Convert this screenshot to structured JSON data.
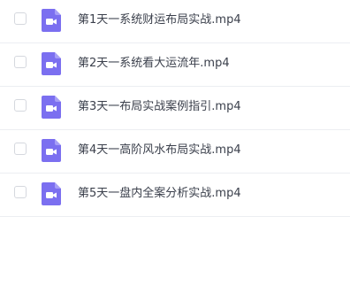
{
  "files": [
    {
      "name": "第1天一系统财运布局实战.mp4",
      "icon": "video-file-icon"
    },
    {
      "name": "第2天一系统看大运流年.mp4",
      "icon": "video-file-icon"
    },
    {
      "name": "第3天一布局实战案例指引.mp4",
      "icon": "video-file-icon"
    },
    {
      "name": "第4天一高阶风水布局实战.mp4",
      "icon": "video-file-icon"
    },
    {
      "name": "第5天一盘内全案分析实战.mp4",
      "icon": "video-file-icon"
    }
  ],
  "colors": {
    "icon_purple": "#7b6ff0",
    "row_divider": "#eceef2",
    "text": "#3a3f4b"
  }
}
